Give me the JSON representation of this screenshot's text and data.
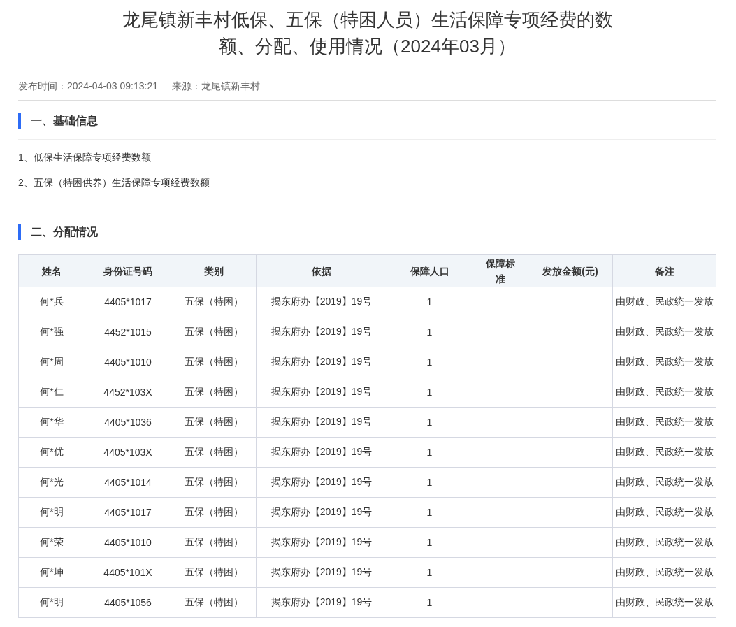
{
  "title": "龙尾镇新丰村低保、五保（特困人员）生活保障专项经费的数额、分配、使用情况（2024年03月）",
  "meta": {
    "publish_label": "发布时间：2024-04-03 09:13:21",
    "source_label": "来源：龙尾镇新丰村"
  },
  "sections": [
    {
      "heading": "一、基础信息",
      "items": [
        "1、低保生活保障专项经费数额",
        "2、五保（特困供养）生活保障专项经费数额"
      ]
    },
    {
      "heading": "二、分配情况",
      "table": {
        "columns": [
          "姓名",
          "身份证号码",
          "类别",
          "依据",
          "保障人口",
          "保障标准",
          "发放金额(元)",
          "备注"
        ],
        "rows": [
          {
            "name": "何*兵",
            "id": "4405*1017",
            "category": "五保（特困）",
            "basis": "揭东府办【2019】19号",
            "population": "1",
            "note": "由财政、民政统一发放"
          },
          {
            "name": "何*强",
            "id": "4452*1015",
            "category": "五保（特困）",
            "basis": "揭东府办【2019】19号",
            "population": "1",
            "note": "由财政、民政统一发放"
          },
          {
            "name": "何*周",
            "id": "4405*1010",
            "category": "五保（特困）",
            "basis": "揭东府办【2019】19号",
            "population": "1",
            "note": "由财政、民政统一发放"
          },
          {
            "name": "何*仁",
            "id": "4452*103X",
            "category": "五保（特困）",
            "basis": "揭东府办【2019】19号",
            "population": "1",
            "note": "由财政、民政统一发放"
          },
          {
            "name": "何*华",
            "id": "4405*1036",
            "category": "五保（特困）",
            "basis": "揭东府办【2019】19号",
            "population": "1",
            "note": "由财政、民政统一发放"
          },
          {
            "name": "何*优",
            "id": "4405*103X",
            "category": "五保（特困）",
            "basis": "揭东府办【2019】19号",
            "population": "1",
            "note": "由财政、民政统一发放"
          },
          {
            "name": "何*光",
            "id": "4405*1014",
            "category": "五保（特困）",
            "basis": "揭东府办【2019】19号",
            "population": "1",
            "note": "由财政、民政统一发放"
          },
          {
            "name": "何*明",
            "id": "4405*1017",
            "category": "五保（特困）",
            "basis": "揭东府办【2019】19号",
            "population": "1",
            "note": "由财政、民政统一发放"
          },
          {
            "name": "何*荣",
            "id": "4405*1010",
            "category": "五保（特困）",
            "basis": "揭东府办【2019】19号",
            "population": "1",
            "note": "由财政、民政统一发放"
          },
          {
            "name": "何*坤",
            "id": "4405*101X",
            "category": "五保（特困）",
            "basis": "揭东府办【2019】19号",
            "population": "1",
            "note": "由财政、民政统一发放"
          },
          {
            "name": "何*明",
            "id": "4405*1056",
            "category": "五保（特困）",
            "basis": "揭东府办【2019】19号",
            "population": "1",
            "note": "由财政、民政统一发放"
          }
        ]
      }
    }
  ]
}
